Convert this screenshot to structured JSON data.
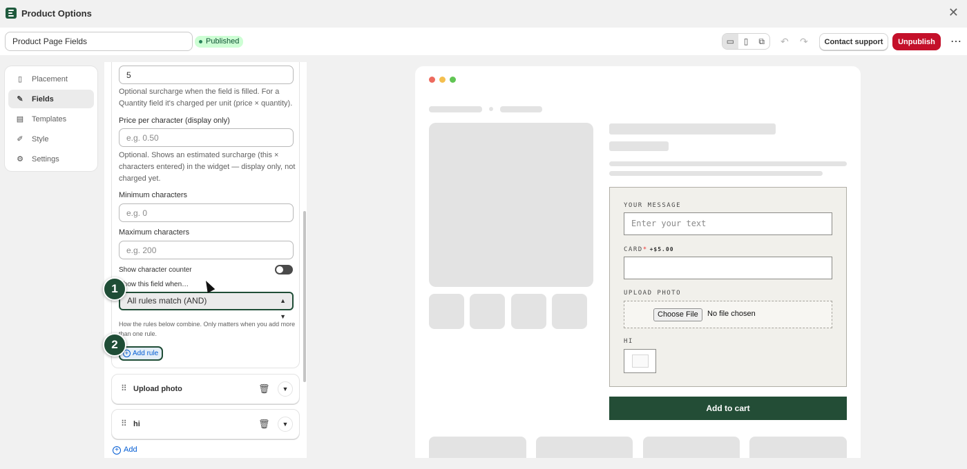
{
  "titlebar": {
    "title": "Product Options"
  },
  "toolbar": {
    "name_value": "Product Page Fields",
    "status_badge": "Published",
    "contact_support": "Contact support",
    "unpublish": "Unpublish"
  },
  "nav": {
    "items": [
      {
        "label": "Placement",
        "icon": "document-icon"
      },
      {
        "label": "Fields",
        "icon": "edit-icon",
        "active": true
      },
      {
        "label": "Templates",
        "icon": "template-icon"
      },
      {
        "label": "Style",
        "icon": "brush-icon"
      },
      {
        "label": "Settings",
        "icon": "gear-icon"
      }
    ]
  },
  "field_editor": {
    "surcharge_value": "5",
    "surcharge_help": "Optional surcharge when the field is filled. For a Quantity field it's charged per unit (price × quantity).",
    "price_per_char_label": "Price per character (display only)",
    "price_per_char_placeholder": "e.g. 0.50",
    "price_per_char_help": "Optional. Shows an estimated surcharge (this × characters entered) in the widget — display only, not charged yet.",
    "min_chars_label": "Minimum characters",
    "min_chars_placeholder": "e.g. 0",
    "max_chars_label": "Maximum characters",
    "max_chars_placeholder": "e.g. 200",
    "char_counter_label": "Show character counter",
    "condition_label": "Show this field when…",
    "condition_select": "All rules match (AND)",
    "condition_help": "How the rules below combine. Only matters when you add more than one rule.",
    "add_rule": "Add rule"
  },
  "steps": [
    "1",
    "2"
  ],
  "field_rows": [
    {
      "name": "Upload photo"
    },
    {
      "name": "hi"
    }
  ],
  "add_field": "Add",
  "preview": {
    "message_label": "YOUR MESSAGE",
    "message_placeholder": "Enter your text",
    "card_label": "CARD",
    "card_required": "*",
    "card_price": "+$5.00",
    "upload_label": "UPLOAD PHOTO",
    "choose_file": "Choose File",
    "no_file": "No file chosen",
    "hi_label": "HI",
    "add_to_cart": "Add to cart"
  },
  "colors": {
    "accent": "#234d36",
    "danger": "#c4102a",
    "link": "#005bd3",
    "published": "#cdfed4"
  }
}
